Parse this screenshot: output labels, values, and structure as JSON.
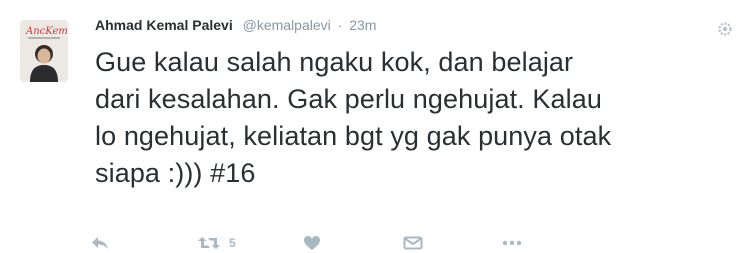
{
  "tweet": {
    "author_name": "Ahmad Kemal Palevi",
    "handle": "@kemalpalevi",
    "separator": "·",
    "timestamp": "23m",
    "text": "Gue kalau salah ngaku kok, dan belajar\ndari kesalahan. Gak perlu ngehujat. Kalau\nlo ngehujat, keliatan bgt yg gak punya otak\nsiapa :))) #16",
    "avatar_logo_text": "AncKemal",
    "retweet_count": "5"
  },
  "icons": {
    "more": "gear-icon",
    "reply": "reply-icon",
    "retweet": "retweet-icon",
    "like": "heart-icon",
    "share": "share-icon",
    "more_actions": "ellipsis-icon"
  },
  "colors": {
    "text": "#292f33",
    "muted": "#8899a6",
    "icon": "#aab8c2",
    "avatar_accent": "#d2383a"
  }
}
